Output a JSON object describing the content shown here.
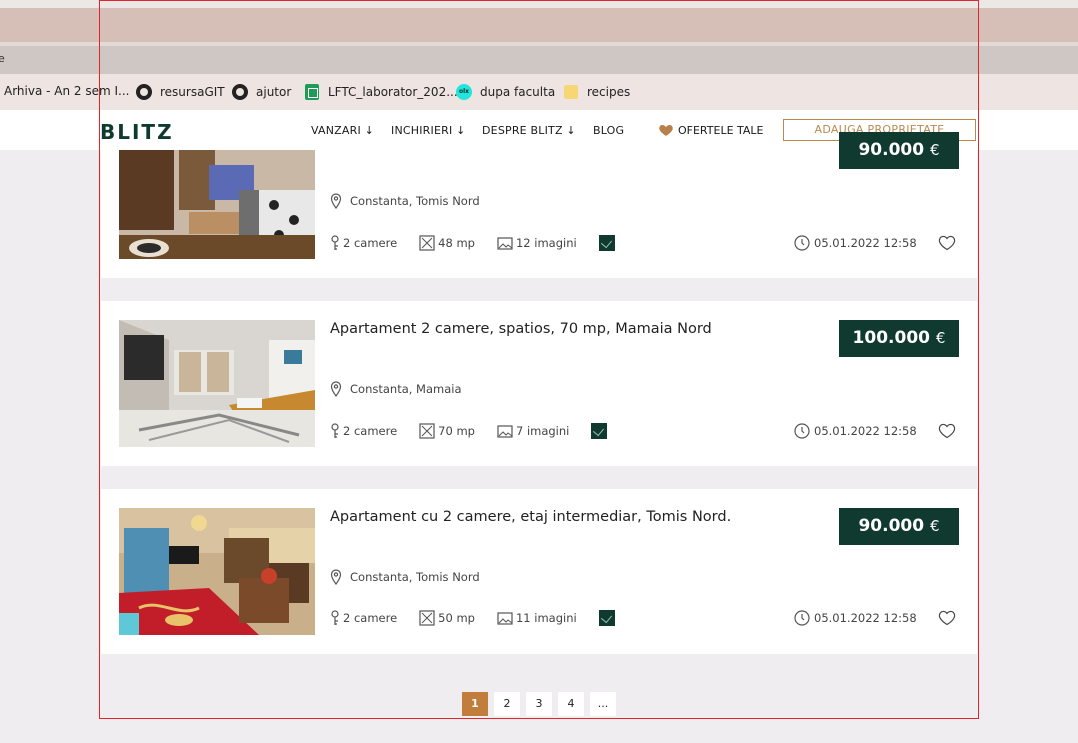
{
  "browser": {
    "strip_glyph": "e",
    "bookmarks": [
      {
        "label": "Arhiva - An 2 sem I...",
        "icon": "bookmark-icon"
      },
      {
        "label": "resursaGIT",
        "icon": "github-icon"
      },
      {
        "label": "ajutor",
        "icon": "github-icon"
      },
      {
        "label": "LFTC_laborator_202...",
        "icon": "sheets-icon"
      },
      {
        "label": "dupa faculta",
        "icon": "olx-icon",
        "icon_text": "olx"
      },
      {
        "label": "recipes",
        "icon": "folder-icon"
      }
    ]
  },
  "site": {
    "logo": "BLITZ",
    "nav": {
      "vanzari": "VANZARI ↓",
      "inchirieri": "INCHIRIERI ↓",
      "despre": "DESPRE BLITZ ↓",
      "blog": "BLOG",
      "ofertele": "OFERTELE TALE",
      "add_property": "ADAUGA PROPRIETATE"
    },
    "colors": {
      "brand_dark": "#10392f",
      "accent": "#c07d3c",
      "button_outline": "#b88a4f"
    }
  },
  "listings": [
    {
      "title": "",
      "price": "90.000",
      "currency": "€",
      "location": "Constanta, Tomis Nord",
      "rooms": "2 camere",
      "area": "48 mp",
      "images": "12 imagini",
      "date": "05.01.2022 12:58"
    },
    {
      "title": "Apartament 2 camere, spatios, 70 mp, Mamaia Nord",
      "price": "100.000",
      "currency": "€",
      "location": "Constanta, Mamaia",
      "rooms": "2 camere",
      "area": "70 mp",
      "images": "7 imagini",
      "date": "05.01.2022 12:58"
    },
    {
      "title": "Apartament cu 2 camere, etaj intermediar, Tomis Nord.",
      "price": "90.000",
      "currency": "€",
      "location": "Constanta, Tomis Nord",
      "rooms": "2 camere",
      "area": "50 mp",
      "images": "11 imagini",
      "date": "05.01.2022 12:58"
    }
  ],
  "pagination": {
    "pages": [
      "1",
      "2",
      "3",
      "4",
      "..."
    ],
    "active": "1"
  }
}
